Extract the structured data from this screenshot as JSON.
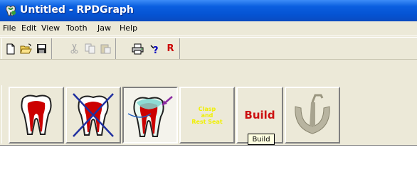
{
  "window": {
    "title": "Untitled - RPDGraph"
  },
  "menu": {
    "items": [
      {
        "label": "File"
      },
      {
        "label": "Edit"
      },
      {
        "label": "View"
      },
      {
        "label": "Tooth"
      },
      {
        "label": "Jaw"
      },
      {
        "label": "Help"
      }
    ]
  },
  "toolbar": {
    "buttons": [
      {
        "icon": "new-document-icon"
      },
      {
        "icon": "open-folder-icon"
      },
      {
        "icon": "save-disk-icon"
      },
      {
        "icon": "cut-icon"
      },
      {
        "icon": "copy-icon"
      },
      {
        "icon": "paste-icon"
      },
      {
        "icon": "print-icon"
      },
      {
        "icon": "help-icon"
      },
      {
        "icon": "r-icon",
        "label": "R"
      }
    ]
  },
  "tools": {
    "buttons": [
      {
        "name": "tooth",
        "icon": "tooth-icon"
      },
      {
        "name": "remove-tooth",
        "icon": "tooth-crossed-icon"
      },
      {
        "name": "tooth-select",
        "icon": "tooth-arrow-icon",
        "pressed": true
      },
      {
        "name": "clasp",
        "icon": "clasp-text-icon",
        "label": "Clasp\nand\nRest Seat"
      },
      {
        "name": "build",
        "label": "Build"
      },
      {
        "name": "jaw",
        "icon": "jaw-arch-icon"
      }
    ],
    "tooltip": "Build"
  },
  "colors": {
    "titlebar": "#0553d2",
    "build_text": "#cc1111",
    "clasp_text": "#f0f000",
    "tooth_pulp": "#cc0000"
  }
}
